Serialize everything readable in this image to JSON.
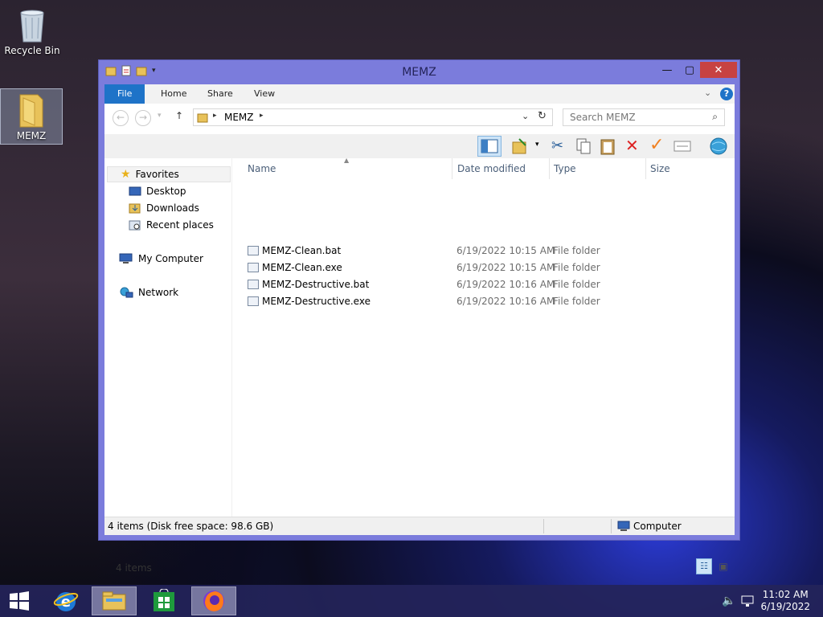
{
  "desktop": {
    "icons": [
      {
        "label": "Recycle Bin"
      },
      {
        "label": "MEMZ"
      }
    ]
  },
  "window": {
    "title": "MEMZ",
    "ribbon_tabs": [
      "File",
      "Home",
      "Share",
      "View"
    ],
    "address": {
      "path": "MEMZ"
    },
    "search": {
      "placeholder": "Search MEMZ"
    },
    "nav": {
      "favorites": "Favorites",
      "desktop": "Desktop",
      "downloads": "Downloads",
      "recent": "Recent places",
      "computer": "My Computer",
      "network": "Network"
    },
    "columns": [
      "Name",
      "Date modified",
      "Type",
      "Size"
    ],
    "files": [
      {
        "name": "MEMZ-Clean.bat",
        "date": "6/19/2022 10:15 AM",
        "type": "File folder"
      },
      {
        "name": "MEMZ-Clean.exe",
        "date": "6/19/2022 10:15 AM",
        "type": "File folder"
      },
      {
        "name": "MEMZ-Destructive.bat",
        "date": "6/19/2022 10:16 AM",
        "type": "File folder"
      },
      {
        "name": "MEMZ-Destructive.exe",
        "date": "6/19/2022 10:16 AM",
        "type": "File folder"
      }
    ],
    "item_count": "4 items",
    "status": "4 items (Disk free space: 98.6 GB)",
    "status_location": "Computer"
  },
  "taskbar": {
    "time": "11:02 AM",
    "date": "6/19/2022"
  },
  "colors": {
    "file_tab": "#1e73c8",
    "window_border": "#7b7cdc",
    "close_button": "#c74242",
    "taskbar": "#24245a"
  }
}
